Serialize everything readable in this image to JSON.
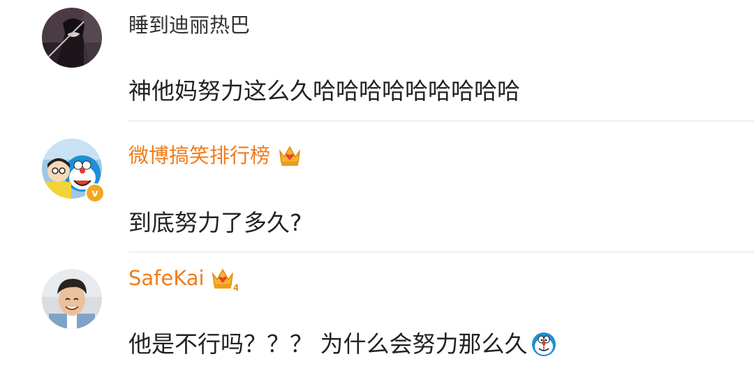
{
  "comments": [
    {
      "username": "睡到迪丽热巴",
      "text": "神他妈努力这么久哈哈哈哈哈哈哈哈哈",
      "vip": false,
      "verified": false,
      "avatar": "avatar-dark-figure-icon"
    },
    {
      "username": "微博搞笑排行榜",
      "text": "到底努力了多久?",
      "vip": true,
      "verified": true,
      "verified_mark": "v",
      "avatar": "avatar-doraemon-nobita-icon",
      "badge": "vip-crown-icon"
    },
    {
      "username": "SafeKai",
      "text": "他是不行吗？？？ 为什么会努力那么久",
      "vip": true,
      "verified": false,
      "avatar": "avatar-smiling-man-icon",
      "badge": "vip-crown-level-4-icon",
      "badge_level": "4",
      "emoji": "doraemon-emoji-icon"
    }
  ],
  "colors": {
    "vip_name": "#f07c1b",
    "normal_name": "#333333",
    "text": "#222222",
    "divider": "#e3e3e3",
    "verified": "#f4a621"
  }
}
